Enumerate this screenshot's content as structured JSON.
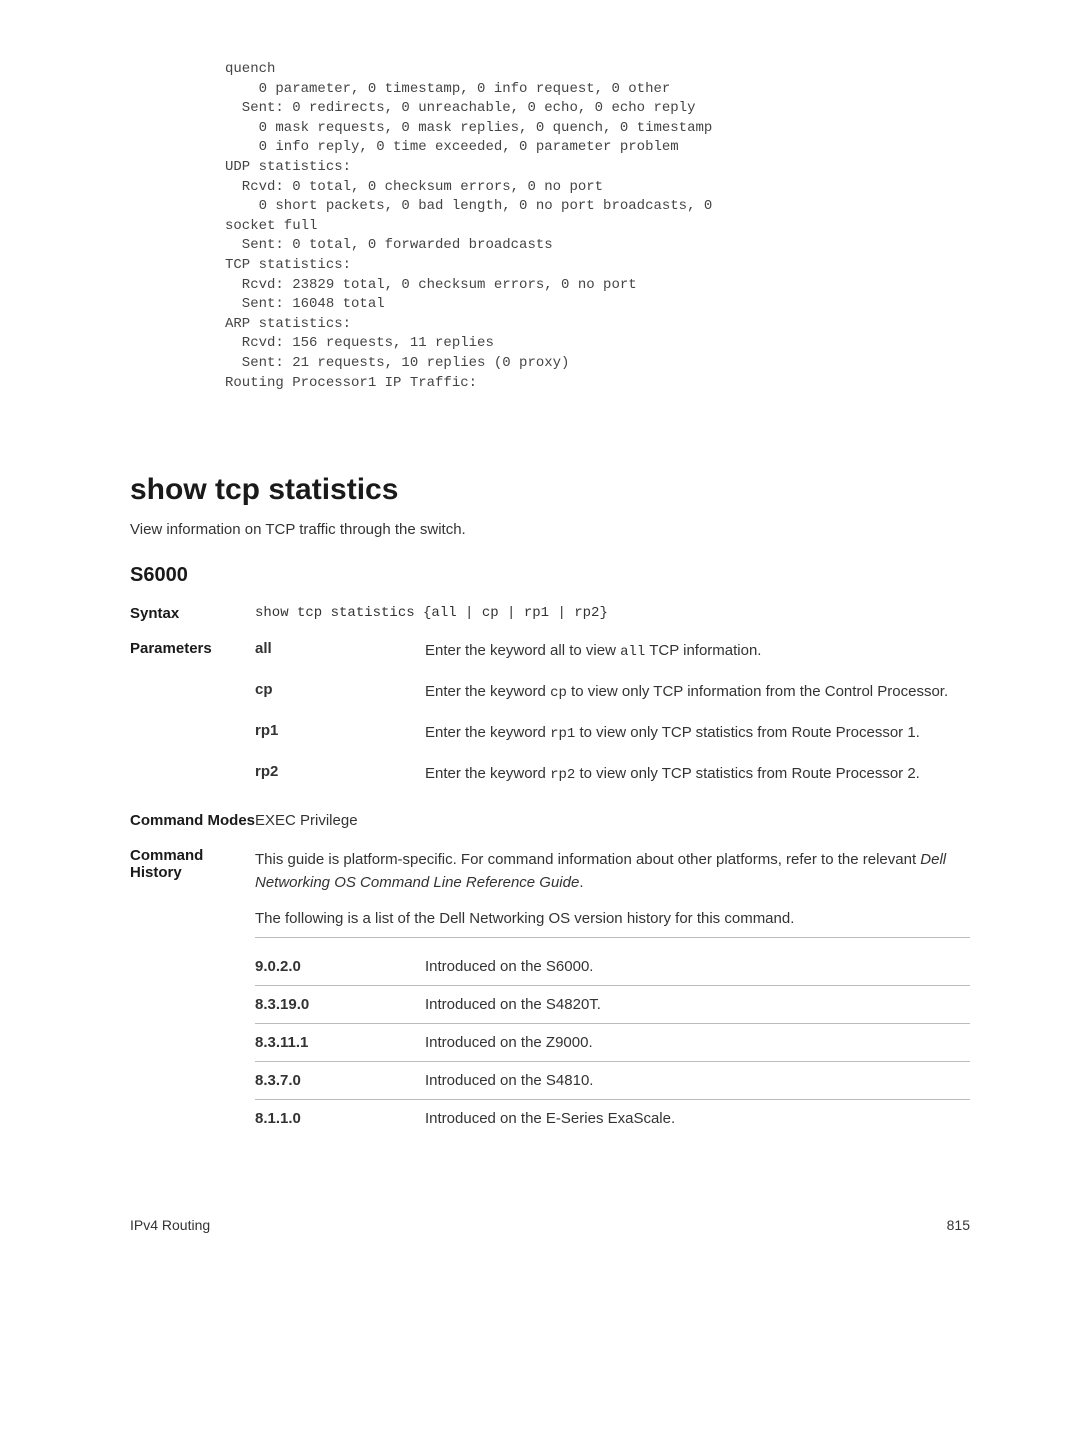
{
  "code_block": "quench\n    0 parameter, 0 timestamp, 0 info request, 0 other\n  Sent: 0 redirects, 0 unreachable, 0 echo, 0 echo reply\n    0 mask requests, 0 mask replies, 0 quench, 0 timestamp\n    0 info reply, 0 time exceeded, 0 parameter problem\nUDP statistics:\n  Rcvd: 0 total, 0 checksum errors, 0 no port\n    0 short packets, 0 bad length, 0 no port broadcasts, 0 \nsocket full\n  Sent: 0 total, 0 forwarded broadcasts\nTCP statistics:\n  Rcvd: 23829 total, 0 checksum errors, 0 no port\n  Sent: 16048 total\nARP statistics:\n  Rcvd: 156 requests, 11 replies\n  Sent: 21 requests, 10 replies (0 proxy)\nRouting Processor1 IP Traffic:",
  "title": "show tcp statistics",
  "description": "View information on TCP traffic through the switch.",
  "model": "S6000",
  "syntax_label": "Syntax",
  "syntax_value": "show tcp statistics {all | cp | rp1 | rp2}",
  "parameters_label": "Parameters",
  "params": [
    {
      "name": "all",
      "pre": "Enter the keyword all to view ",
      "code": "all",
      "post": " TCP information."
    },
    {
      "name": "cp",
      "pre": "Enter the keyword ",
      "code": "cp",
      "post": " to view only TCP information from the Control Processor."
    },
    {
      "name": "rp1",
      "pre": "Enter the keyword ",
      "code": "rp1",
      "post": " to view only TCP statistics from Route Processor 1."
    },
    {
      "name": "rp2",
      "pre": "Enter the keyword ",
      "code": "rp2",
      "post": " to view only TCP statistics from Route Processor 2."
    }
  ],
  "modes_label": "Command Modes",
  "modes_value": "EXEC Privilege",
  "history_label": "Command History",
  "history_text1": "This guide is platform-specific. For command information about other platforms, refer to the relevant ",
  "history_italic": "Dell Networking OS Command Line Reference Guide",
  "history_text2": ".",
  "history_intro": "The following is a list of the Dell Networking OS version history for this command.",
  "history": [
    {
      "ver": "9.0.2.0",
      "desc": "Introduced on the S6000."
    },
    {
      "ver": "8.3.19.0",
      "desc": "Introduced on the S4820T."
    },
    {
      "ver": "8.3.11.1",
      "desc": "Introduced on the Z9000."
    },
    {
      "ver": "8.3.7.0",
      "desc": "Introduced on the S4810."
    },
    {
      "ver": "8.1.1.0",
      "desc": "Introduced on the E-Series ExaScale."
    }
  ],
  "footer_left": "IPv4 Routing",
  "footer_right": "815"
}
